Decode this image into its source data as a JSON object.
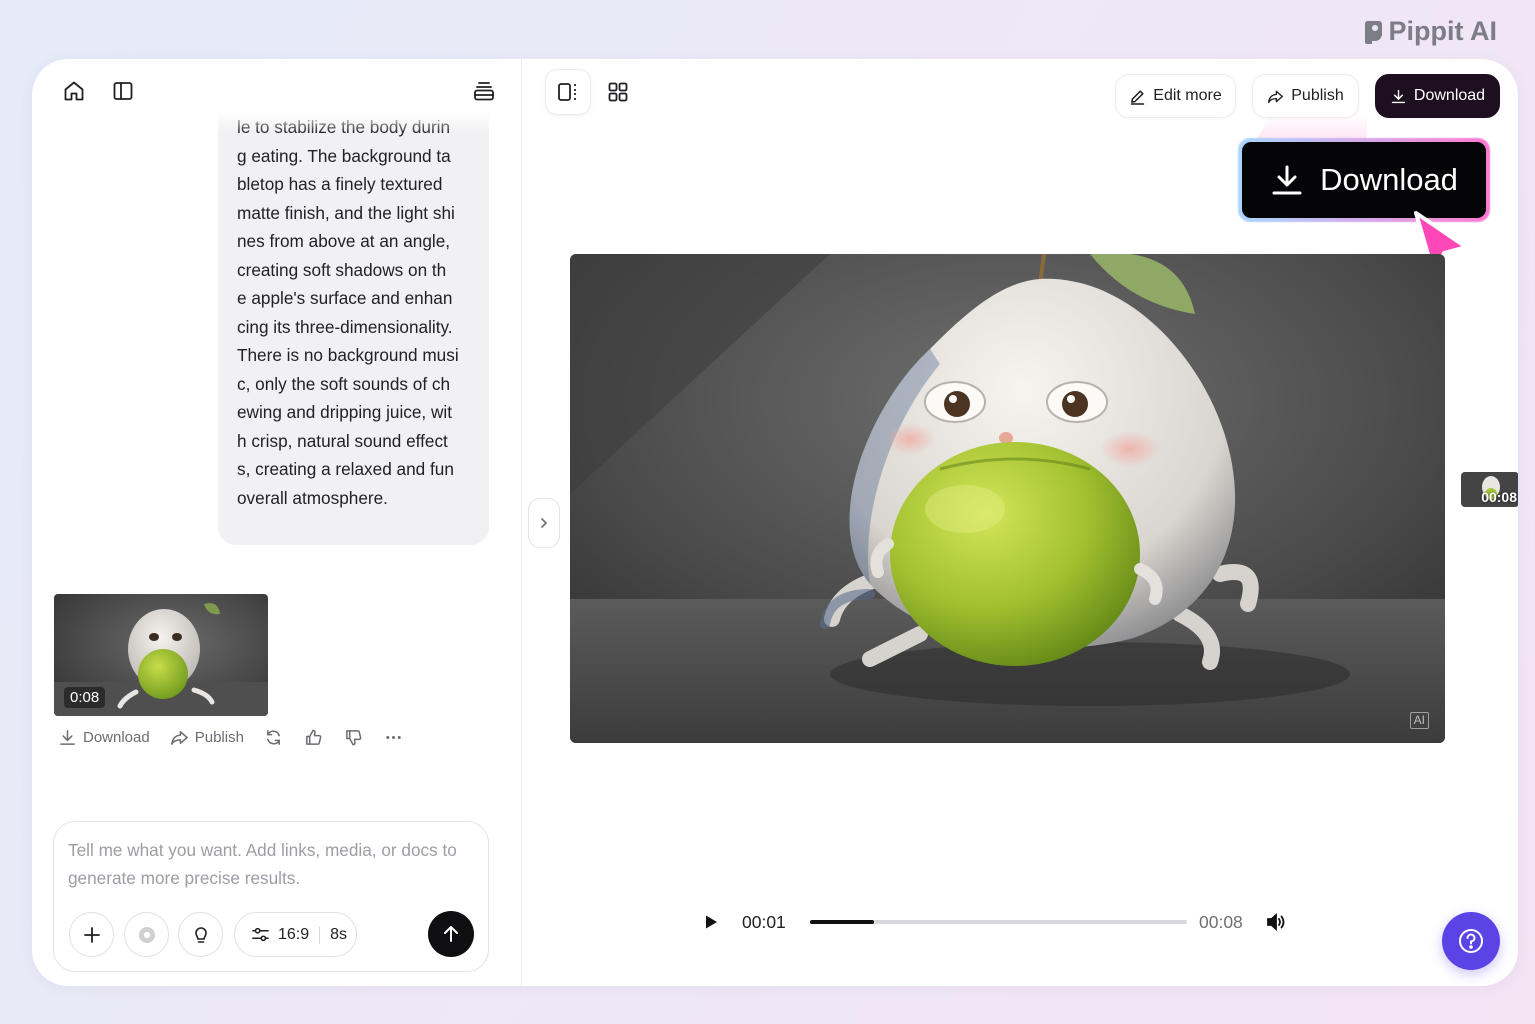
{
  "brand": {
    "name": "Pippit AI"
  },
  "left_toolbar": {
    "home_icon": "home-icon",
    "sidebar_icon": "sidebar-toggle-icon",
    "history_icon": "stack-icon"
  },
  "chat": {
    "message_text": "le to stabilize the body durin\ng eating. The background ta\nbletop has a finely textured\nmatte finish, and the light shi\nnes from above at an angle,\ncreating soft shadows on th\ne apple's surface and enhan\ncing its three-dimensionality.\nThere is no background musi\nc, only the soft sounds of ch\newing and dripping juice, wit\nh crisp, natural sound effect\ns, creating a relaxed and fun\noverall atmosphere.",
    "result": {
      "duration": "0:08",
      "actions": {
        "download_label": "Download",
        "publish_label": "Publish",
        "regenerate_icon": "refresh-icon",
        "like_icon": "thumbs-up-icon",
        "dislike_icon": "thumbs-down-icon",
        "more_icon": "more-icon"
      }
    }
  },
  "composer": {
    "placeholder": "Tell me what you want. Add links, media, or docs to generate more precise results.",
    "value": "",
    "aspect_ratio": "16:9",
    "duration": "8s"
  },
  "header": {
    "edit_more_label": "Edit more",
    "publish_label": "Publish",
    "download_label": "Download"
  },
  "callout": {
    "download_label": "Download"
  },
  "preview": {
    "ai_badge": "AI",
    "side_thumb_duration": "00:08"
  },
  "player": {
    "current_time": "00:01",
    "total_time": "00:08",
    "progress": 0.17
  },
  "colors": {
    "accent_dark": "#1d0f1f",
    "help_button": "#5b43e6",
    "callout_glow_pink": "#ff7ad0",
    "callout_glow_blue": "#a9d7ff"
  }
}
